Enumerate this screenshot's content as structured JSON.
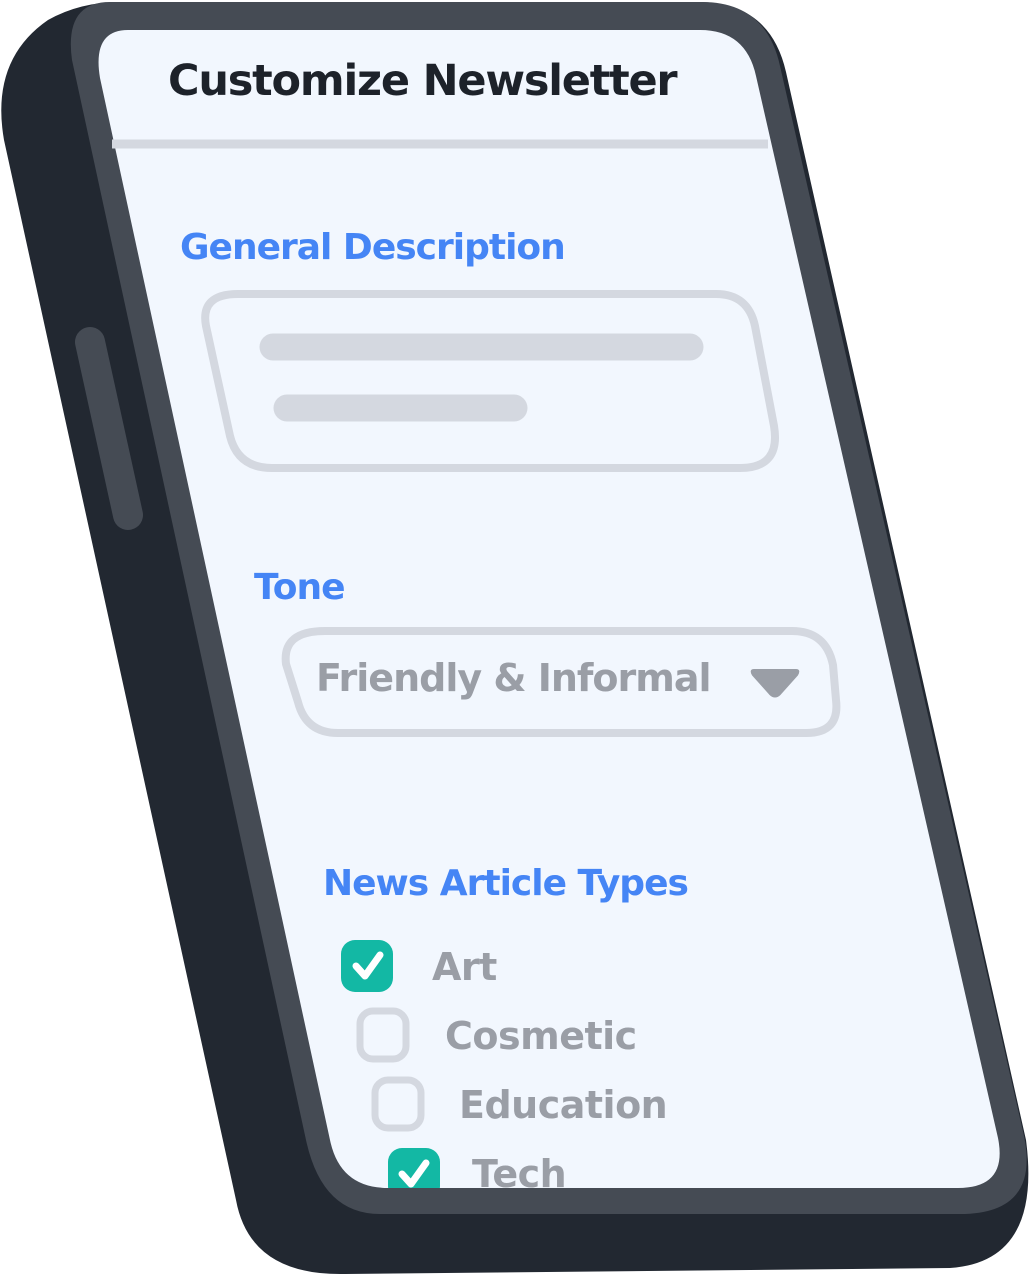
{
  "header": {
    "title": "Customize Newsletter"
  },
  "general_description": {
    "label": "General Description"
  },
  "tone": {
    "label": "Tone",
    "selected": "Friendly & Informal",
    "dropdown_icon": "caret-down-icon"
  },
  "article_types": {
    "label": "News Article Types",
    "items": [
      {
        "label": "Art",
        "checked": true
      },
      {
        "label": "Cosmetic",
        "checked": false
      },
      {
        "label": "Education",
        "checked": false
      },
      {
        "label": "Tech",
        "checked": true
      }
    ]
  },
  "colors": {
    "accent": "#4585f5",
    "check": "#13b8a4",
    "frame": "#222831",
    "bezel": "#454b54",
    "screen": "#f2f7fe",
    "muted": "#d4d8e0"
  }
}
